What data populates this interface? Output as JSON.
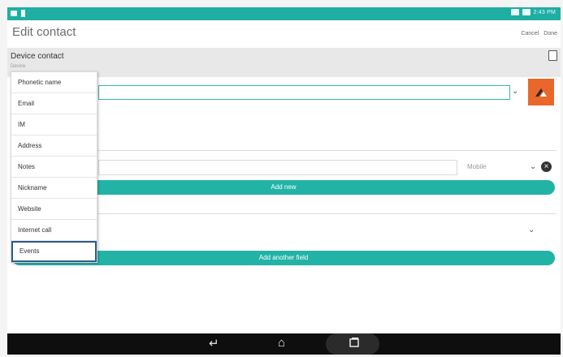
{
  "status_bar": {
    "time": "2:43 PM"
  },
  "header": {
    "title": "Edit contact",
    "cancel_label": "Cancel",
    "done_label": "Done"
  },
  "account": {
    "title": "Device contact",
    "subtitle": "Device"
  },
  "field_menu": {
    "items": [
      "Phonetic name",
      "Email",
      "IM",
      "Address",
      "Notes",
      "Nickname",
      "Website",
      "Internet call",
      "Events"
    ],
    "selected": "Events"
  },
  "phone": {
    "type": "Mobile",
    "add_new_label": "Add new"
  },
  "add_field_label": "Add another field",
  "icons": {
    "photo": "contact-photo-icon",
    "back": "back-icon",
    "home": "home-icon",
    "recents": "recent-apps-icon",
    "clear": "clear-icon",
    "chevron": "chevron-down-icon"
  },
  "colors": {
    "accent": "#22b3a6",
    "status_bar": "#1eaea3",
    "photo_bg": "#e9672b",
    "selected_border": "#2d5d86"
  }
}
